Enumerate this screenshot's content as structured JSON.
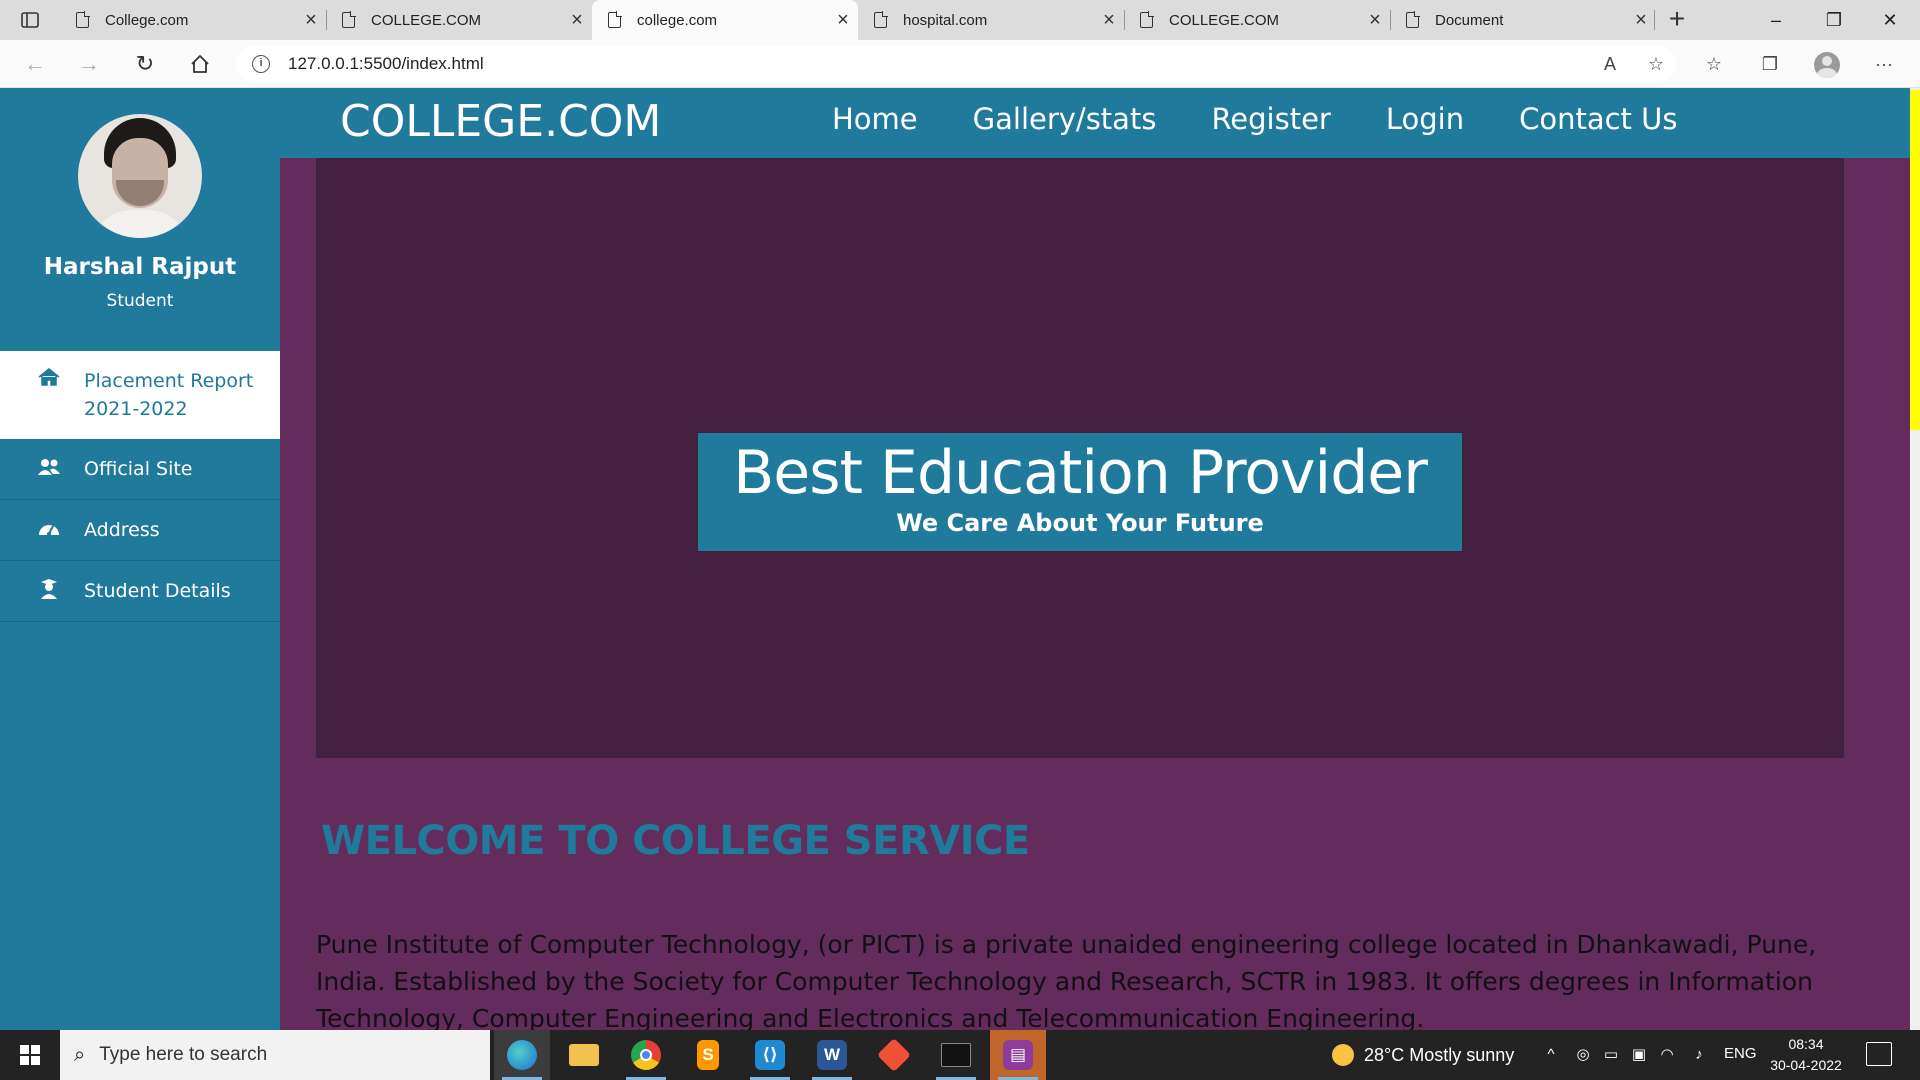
{
  "browser": {
    "tabs": [
      {
        "title": "College.com",
        "active": false
      },
      {
        "title": "COLLEGE.COM",
        "active": false
      },
      {
        "title": "college.com",
        "active": true
      },
      {
        "title": "hospital.com",
        "active": false
      },
      {
        "title": "COLLEGE.COM",
        "active": false
      },
      {
        "title": "Document",
        "active": false
      }
    ],
    "close_glyph": "×",
    "new_tab_glyph": "+",
    "url": "127.0.0.1:5500/index.html",
    "window_controls": {
      "minimize": "–",
      "restore": "❐",
      "close": "✕"
    }
  },
  "page": {
    "brand": "COLLEGE.COM",
    "nav": [
      "Home",
      "Gallery/stats",
      "Register",
      "Login",
      "Contact Us"
    ],
    "profile": {
      "name": "Harshal Rajput",
      "role": "Student"
    },
    "menu": [
      {
        "label": "Placement Report 2021-2022",
        "icon": "home-icon",
        "active": true
      },
      {
        "label": "Official Site",
        "icon": "users-icon",
        "active": false
      },
      {
        "label": "Address",
        "icon": "dashboard-icon",
        "active": false
      },
      {
        "label": "Student Details",
        "icon": "student-icon",
        "active": false
      }
    ],
    "hero": {
      "title": "Best Education Provider",
      "subtitle": "We Care About Your Future"
    },
    "welcome_heading": "WELCOME TO COLLEGE SERVICE",
    "about_text": "Pune Institute of Computer Technology, (or PICT) is a private unaided engineering college located in Dhankawadi, Pune, India. Established by the Society for Computer Technology and Research, SCTR in 1983. It offers degrees in Information Technology, Computer Engineering and Electronics and Telecommunication Engineering.",
    "colors": {
      "primary": "#207a9b",
      "background": "#632c5c",
      "hero": "#43203f",
      "scroll_thumb": "#ffff00"
    }
  },
  "taskbar": {
    "search_placeholder": "Type here to search",
    "apps": [
      "edge",
      "file-explorer",
      "chrome",
      "sublime-text",
      "vscode",
      "word",
      "git",
      "terminal",
      "winrar"
    ],
    "weather": "28°C  Mostly sunny",
    "language": "ENG",
    "time": "08:34",
    "date": "30-04-2022"
  }
}
